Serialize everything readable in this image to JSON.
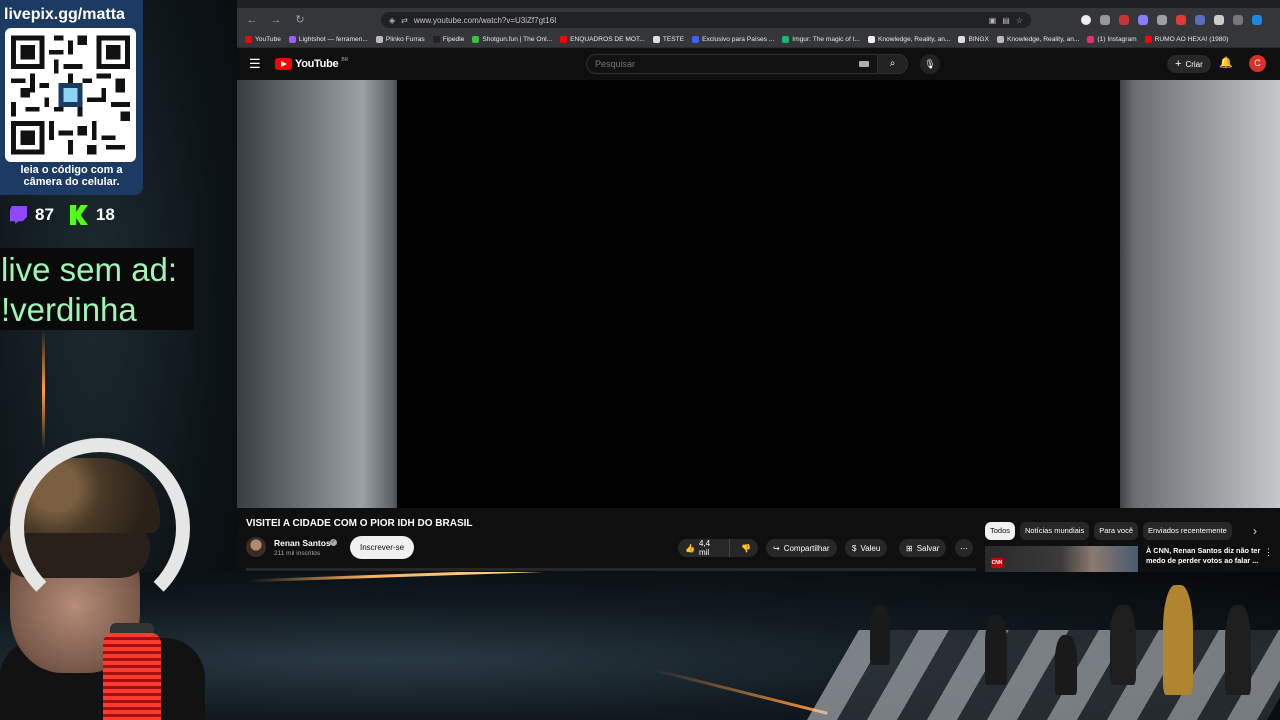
{
  "overlay": {
    "qr_url": "livepix.gg/matta",
    "qr_caption_line1": "leia o código com a",
    "qr_caption_line2": "câmera do celular.",
    "twitch_count": "87",
    "kick_count": "18",
    "ad_line1": "live sem ad:",
    "ad_line2": "!verdinha"
  },
  "browser": {
    "url": "www.youtube.com/watch?v=U3iZf7gt16I",
    "bookmarks": [
      {
        "label": "YouTube",
        "color": "#ff0000"
      },
      {
        "label": "Lightshot — ferramen...",
        "color": "#a05cff"
      },
      {
        "label": "Plinko Furras",
        "color": "#bbbbbb"
      },
      {
        "label": "Fipedle",
        "color": "#222222"
      },
      {
        "label": "Shotgun.fun | The Onl...",
        "color": "#3cbf3c"
      },
      {
        "label": "ENQUADROS DE MOT...",
        "color": "#ff0000"
      },
      {
        "label": "TESTE",
        "color": "#dddddd"
      },
      {
        "label": "Exclusivo para Países ...",
        "color": "#4060ff"
      },
      {
        "label": "Imgur: The magic of t...",
        "color": "#1bb76e"
      },
      {
        "label": "Knowledge, Reality, an...",
        "color": "#eeeeee"
      },
      {
        "label": "BINGX",
        "color": "#dddddd"
      },
      {
        "label": "Knowledge, Reality, an...",
        "color": "#bbbbbb"
      },
      {
        "label": "(1) Instagram",
        "color": "#e1306c"
      },
      {
        "label": "RUMO AO HEXA! (1980)",
        "color": "#ff0000"
      }
    ]
  },
  "youtube": {
    "logo_text": "YouTube",
    "logo_region": "BR",
    "search_placeholder": "Pesquisar",
    "create_label": "Criar",
    "avatar_letter": "C",
    "video_title": "VISITEI A CIDADE COM O PIOR IDH DO BRASIL",
    "channel_name": "Renan Santos",
    "subscribers": "211 mil inscritos",
    "subscribe_label": "Inscrever-se",
    "likes": "4,4 mil",
    "share_label": "Compartilhar",
    "thanks_label": "Valeu",
    "save_label": "Salvar",
    "chips": [
      {
        "label": "Todos",
        "active": true
      },
      {
        "label": "Notícias mundiais",
        "active": false
      },
      {
        "label": "Para você",
        "active": false
      },
      {
        "label": "Enviados recentemente",
        "active": false
      }
    ],
    "recommended_title": "À CNN, Renan Santos diz não ter medo de perder votos ao falar ...",
    "recommended_badge": "CNN"
  },
  "colors": {
    "qr_card": "#1d3a63",
    "ad_text": "#9ef5b5",
    "yt_red": "#ff0000",
    "twitch": "#9147ff",
    "kick": "#53fc18"
  }
}
